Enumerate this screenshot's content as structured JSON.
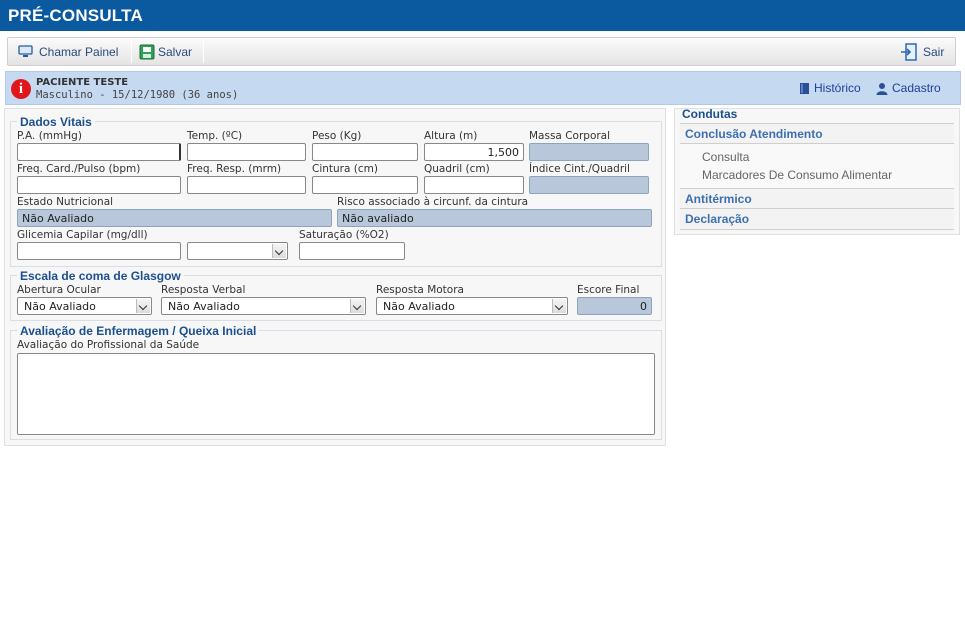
{
  "app": {
    "title": "PRÉ-CONSULTA"
  },
  "toolbar": {
    "chamar_painel": "Chamar Painel",
    "salvar": "Salvar",
    "sair": "Sair"
  },
  "patient": {
    "name": "PACIENTE TESTE",
    "info": "Masculino - 15/12/1980 (36 anos)",
    "historico": "Histórico",
    "cadastro": "Cadastro"
  },
  "dados_vitais": {
    "legend": "Dados Vitais",
    "pa_label": "P.A. (mmHg)",
    "pa_value": "",
    "temp_label": "Temp. (ºC)",
    "temp_value": "",
    "peso_label": "Peso (Kg)",
    "peso_value": "",
    "altura_label": "Altura (m)",
    "altura_value": "1,500",
    "massa_label": "Massa Corporal",
    "massa_value": "",
    "freq_card_label": "Freq. Card./Pulso (bpm)",
    "freq_card_value": "",
    "freq_resp_label": "Freq. Resp. (mrm)",
    "freq_resp_value": "",
    "cintura_label": "Cintura (cm)",
    "cintura_value": "",
    "quadril_label": "Quadril (cm)",
    "quadril_value": "",
    "indice_label": "Índice Cint./Quadril",
    "indice_value": "",
    "estado_label": "Estado Nutricional",
    "estado_value": "Não Avaliado",
    "risco_label": "Risco associado à circunf. da cintura",
    "risco_value": "Não avaliado",
    "glicemia_label": "Glicemia Capilar (mg/dll)",
    "glicemia_value": "",
    "glicemia_select": "",
    "saturacao_label": "Saturação (%O2)",
    "saturacao_value": ""
  },
  "glasgow": {
    "legend": "Escala de coma de Glasgow",
    "ocular_label": "Abertura Ocular",
    "ocular_value": "Não Avaliado",
    "verbal_label": "Resposta Verbal",
    "verbal_value": "Não Avaliado",
    "motora_label": "Resposta Motora",
    "motora_value": "Não Avaliado",
    "escore_label": "Escore Final",
    "escore_value": "0"
  },
  "avaliacao": {
    "legend": "Avaliação de Enfermagem / Queixa Inicial",
    "prof_label": "Avaliação do Profissional da Saúde",
    "prof_value": ""
  },
  "condutas": {
    "title": "Condutas",
    "sections": [
      {
        "label": "Conclusão Atendimento",
        "items": [
          "Consulta",
          "Marcadores De Consumo Alimentar"
        ]
      },
      {
        "label": "Antitérmico"
      },
      {
        "label": "Declaração"
      }
    ]
  },
  "colors": {
    "header": "#0b5aa0",
    "patient_bar": "#c5d9f1",
    "legend": "#1b4f8e",
    "warning": "#e0161b"
  }
}
